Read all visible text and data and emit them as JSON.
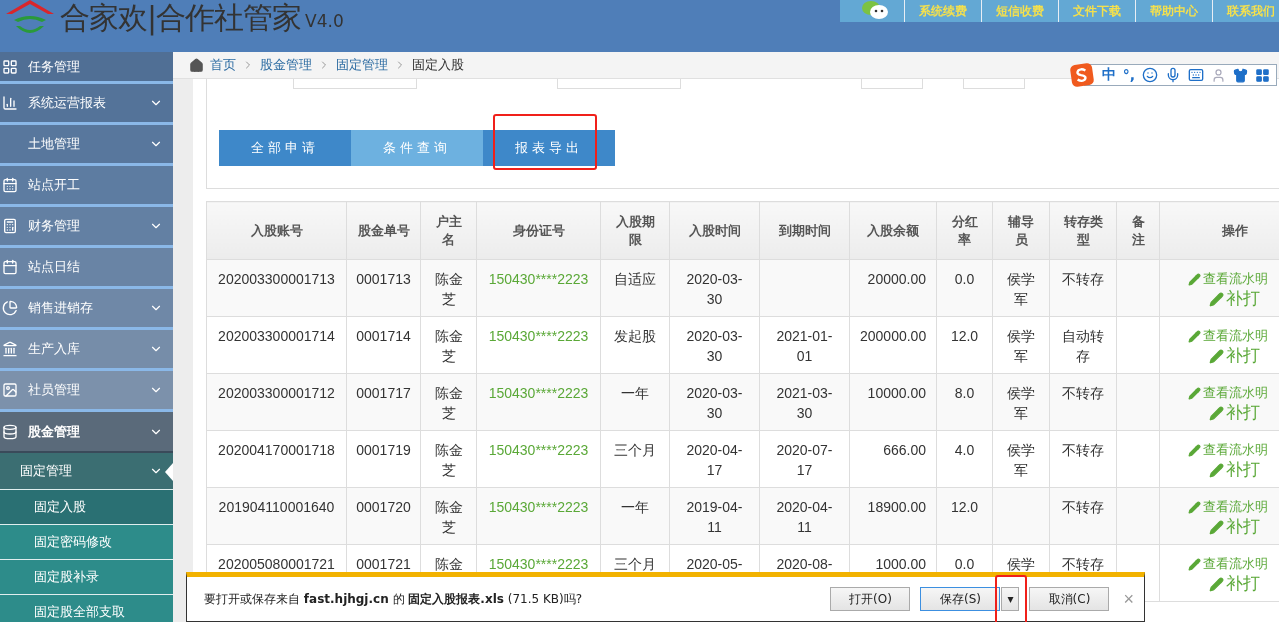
{
  "header": {
    "title": "合家欢|合作社管家",
    "version": "V4.0",
    "nav": [
      "系统续费",
      "短信收费",
      "文件下载",
      "帮助中心",
      "联系我们"
    ]
  },
  "sidebar": {
    "items": [
      {
        "label": "任务管理",
        "kind": "link",
        "selected": false
      },
      {
        "label": "系统运营报表",
        "kind": "group",
        "selected": false
      },
      {
        "label": "土地管理",
        "kind": "group",
        "selected": false
      },
      {
        "label": "站点开工",
        "kind": "link",
        "selected": false
      },
      {
        "label": "财务管理",
        "kind": "group",
        "selected": false
      },
      {
        "label": "站点日结",
        "kind": "link",
        "selected": false
      },
      {
        "label": "销售进销存",
        "kind": "group",
        "selected": false
      },
      {
        "label": "生产入库",
        "kind": "group",
        "selected": false
      },
      {
        "label": "社员管理",
        "kind": "group",
        "selected": false
      },
      {
        "label": "股金管理",
        "kind": "group",
        "selected": false,
        "children": [
          {
            "label": "固定管理",
            "kind": "group",
            "selected": false,
            "children": [
              {
                "label": "固定入股",
                "kind": "link",
                "selected": true
              },
              {
                "label": "固定密码修改",
                "kind": "link",
                "selected": false
              },
              {
                "label": "固定股补录",
                "kind": "link",
                "selected": false
              },
              {
                "label": "固定股全部支取",
                "kind": "link",
                "selected": false
              }
            ]
          }
        ]
      }
    ]
  },
  "breadcrumb": [
    "首页",
    "股金管理",
    "固定管理",
    "固定入股"
  ],
  "ime_bar": {
    "mode": "中",
    "punctuation": "°,"
  },
  "actions": [
    {
      "label": "全部申请",
      "selected": false,
      "highlighted": false
    },
    {
      "label": "条件查询",
      "selected": true,
      "highlighted": false
    },
    {
      "label": "报表导出",
      "selected": false,
      "highlighted": true
    }
  ],
  "table": {
    "columns": [
      "入股账号",
      "股金单号",
      "户主名",
      "身份证号",
      "入股期限",
      "入股时间",
      "到期时间",
      "入股余额",
      "分红率",
      "辅导员",
      "转存类型",
      "备注",
      "操作"
    ],
    "rows": [
      {
        "cells": [
          "202003300001713",
          "0001713",
          "陈金芝",
          "150430****2223",
          "自适应",
          "2020-03-30",
          "",
          "20000.00",
          "0.0",
          "侯学军",
          "不转存",
          ""
        ],
        "actions": [
          "查看流水明",
          "补打"
        ]
      },
      {
        "cells": [
          "202003300001714",
          "0001714",
          "陈金芝",
          "150430****2223",
          "发起股",
          "2020-03-30",
          "2021-01-01",
          "200000.00",
          "12.0",
          "侯学军",
          "自动转存",
          ""
        ],
        "actions": [
          "查看流水明",
          "补打"
        ]
      },
      {
        "cells": [
          "202003300001712",
          "0001717",
          "陈金芝",
          "150430****2223",
          "一年",
          "2020-03-30",
          "2021-03-30",
          "10000.00",
          "8.0",
          "侯学军",
          "不转存",
          ""
        ],
        "actions": [
          "查看流水明",
          "补打"
        ]
      },
      {
        "cells": [
          "202004170001718",
          "0001719",
          "陈金芝",
          "150430****2223",
          "三个月",
          "2020-04-17",
          "2020-07-17",
          "666.00",
          "4.0",
          "侯学军",
          "不转存",
          ""
        ],
        "actions": [
          "查看流水明",
          "补打"
        ]
      },
      {
        "cells": [
          "201904110001640",
          "0001720",
          "陈金芝",
          "150430****2223",
          "一年",
          "2019-04-11",
          "2020-04-11",
          "18900.00",
          "12.0",
          "",
          "不转存",
          ""
        ],
        "actions": [
          "查看流水明",
          "补打"
        ]
      },
      {
        "cells": [
          "202005080001721",
          "0001721",
          "陈金",
          "150430****2223",
          "三个月",
          "2020-05-",
          "2020-08-",
          "1000.00",
          "0.0",
          "侯学",
          "不转存",
          ""
        ],
        "actions": [
          "查看流水明",
          "补打"
        ]
      }
    ]
  },
  "download_bar": {
    "message": "要打开或保存来自 **fast.hjhgj.cn** 的 **固定入股报表.xls** (71.5 KB)吗?",
    "buttons": [
      {
        "label": "打开(O)",
        "kind": "plain",
        "focused": false,
        "highlighted": false
      },
      {
        "label": "保存(S)",
        "kind": "plain",
        "focused": true,
        "highlighted": false
      },
      {
        "label": "▾",
        "kind": "menu",
        "focused": false,
        "highlighted": true
      },
      {
        "label": "取消(C)",
        "kind": "plain",
        "focused": false,
        "highlighted": false
      }
    ],
    "close": "×"
  }
}
